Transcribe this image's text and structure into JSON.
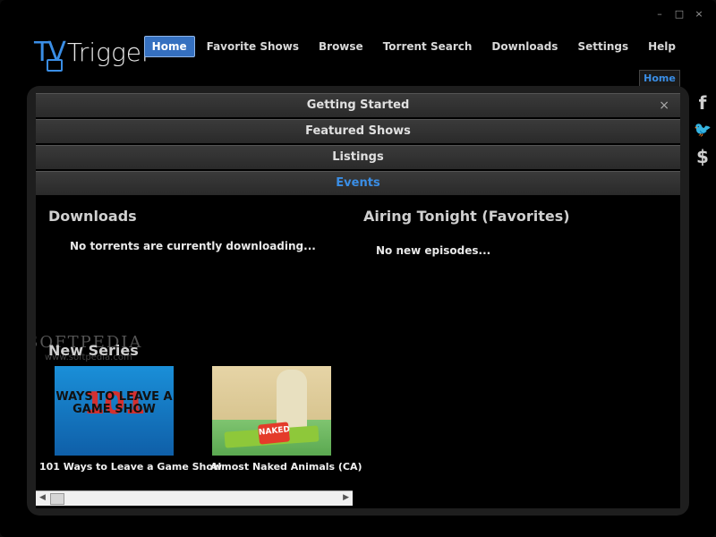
{
  "window": {
    "controls": [
      "–",
      "□",
      "×"
    ]
  },
  "logo": {
    "tv": "TV",
    "trigger": "Trigger"
  },
  "nav": [
    {
      "label": "Home",
      "active": true
    },
    {
      "label": "Favorite Shows",
      "active": false
    },
    {
      "label": "Browse",
      "active": false
    },
    {
      "label": "Torrent Search",
      "active": false
    },
    {
      "label": "Downloads",
      "active": false
    },
    {
      "label": "Settings",
      "active": false
    },
    {
      "label": "Help",
      "active": false
    }
  ],
  "home_tab": "Home",
  "accordion": [
    {
      "label": "Getting Started",
      "active": false,
      "closable": true
    },
    {
      "label": "Featured Shows",
      "active": false
    },
    {
      "label": "Listings",
      "active": false
    },
    {
      "label": "Events",
      "active": true
    }
  ],
  "close_symbol": "×",
  "downloads": {
    "title": "Downloads",
    "message": "No torrents are currently downloading..."
  },
  "airing": {
    "title": "Airing Tonight (Favorites)",
    "message": "No new episodes..."
  },
  "watermark": {
    "brand": "SOFTPEDIA",
    "url": "www.softpedia.com"
  },
  "new_series": {
    "title": "New Series",
    "shows": [
      {
        "label": "101 Ways to Leave a Game Show",
        "thumb_text_big": "101",
        "thumb_text_small": "WAYS TO LEAVE A GAME SHOW"
      },
      {
        "label": "Almost Naked Animals (CA)",
        "thumb_text_big": "NAKED",
        "thumb_text_small": ""
      }
    ]
  },
  "scrollbar": {
    "left_arrow": "◀",
    "right_arrow": "▶"
  },
  "social": {
    "facebook": "f",
    "twitter": "🐦",
    "donate": "$"
  },
  "colors": {
    "accent": "#3a8ee6",
    "nav_active_bg": "#3570c0",
    "panel_bg": "#1e1e1e"
  }
}
